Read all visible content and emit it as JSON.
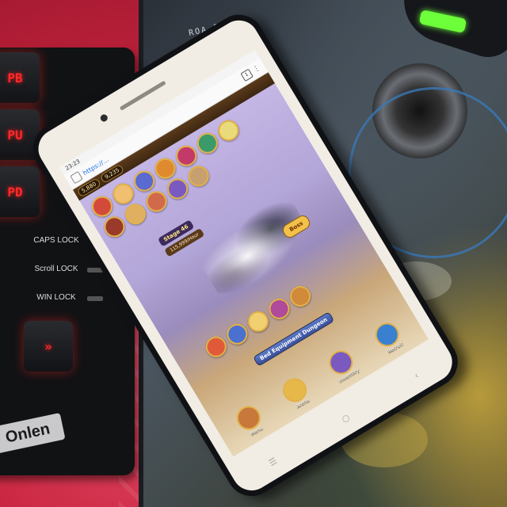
{
  "keyboard": {
    "keys": [
      "PB",
      "PU",
      "PD"
    ],
    "indicators": [
      "CAPS LOCK",
      "Scroll LOCK",
      "WIN LOCK"
    ],
    "arrow_key_glyph": "»",
    "brand": "Onlen"
  },
  "mousepad": {
    "text": "ROA-PA"
  },
  "phone": {
    "status_time": "23:23",
    "browser": {
      "url": "https://...",
      "tab_count": "1"
    },
    "game": {
      "resources": [
        "5,880",
        "9,235"
      ],
      "stage_label": "Stage 46",
      "hourly_label": "115,999/Hour",
      "boss_button": "Boss",
      "dungeon_button": "Bed Equipment Dungeon",
      "menu": [
        "Menu",
        "Arena",
        "Inventory",
        "Recruit"
      ]
    },
    "nav_keys": [
      "☰",
      "○",
      "‹"
    ]
  },
  "colors": {
    "desk_red": "#c92a45",
    "key_glow": "#ff2a2a",
    "mouse_led": "#6cff3a",
    "phone_body": "#f1ede4",
    "game_gold": "#e2b24a"
  }
}
